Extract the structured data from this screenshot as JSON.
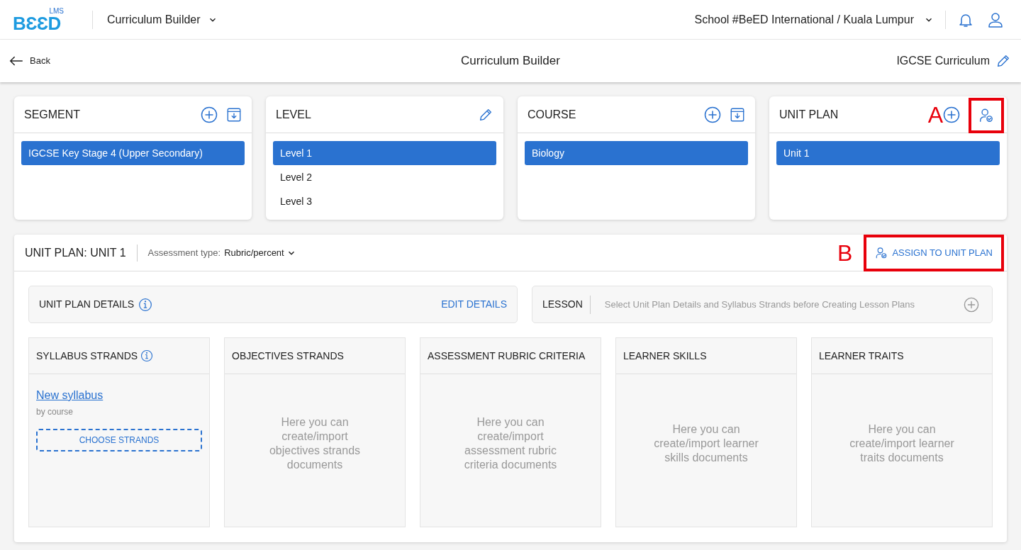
{
  "header": {
    "logo": {
      "wordmark": "BƐƐD",
      "tag": "LMS"
    },
    "app_switcher": "Curriculum Builder",
    "school": "School #BeED International / Kuala Lumpur"
  },
  "subheader": {
    "back": "Back",
    "title": "Curriculum Builder",
    "curriculum": "IGCSE Curriculum"
  },
  "panels": [
    {
      "title": "SEGMENT",
      "actions": [
        {
          "kind": "add"
        },
        {
          "kind": "archive"
        }
      ],
      "items": [
        {
          "label": "IGCSE Key Stage 4 (Upper Secondary)",
          "selected": true
        }
      ]
    },
    {
      "title": "LEVEL",
      "actions": [
        {
          "kind": "edit"
        }
      ],
      "items": [
        {
          "label": "Level 1",
          "selected": true
        },
        {
          "label": "Level 2",
          "selected": false
        },
        {
          "label": "Level 3",
          "selected": false
        }
      ]
    },
    {
      "title": "COURSE",
      "actions": [
        {
          "kind": "add"
        },
        {
          "kind": "archive"
        }
      ],
      "items": [
        {
          "label": "Biology",
          "selected": true
        }
      ]
    },
    {
      "title": "UNIT PLAN",
      "actions": [
        {
          "kind": "add",
          "annotation": "A"
        },
        {
          "kind": "assign",
          "highlighted": true
        }
      ],
      "items": [
        {
          "label": "Unit 1",
          "selected": true
        }
      ]
    }
  ],
  "unit_plan": {
    "title": "UNIT PLAN: UNIT 1",
    "assessment_label": "Assessment type:",
    "assessment_value": "Rubric/percent",
    "assign_annotation": "B",
    "assign_button": "ASSIGN TO UNIT PLAN",
    "details": {
      "title": "UNIT PLAN DETAILS",
      "action": "EDIT DETAILS"
    },
    "lesson": {
      "title": "LESSON",
      "hint": "Select Unit Plan Details and Syllabus Strands before Creating Lesson Plans"
    },
    "columns": [
      {
        "kind": "syllabus",
        "title": "SYLLABUS STRANDS",
        "link": "New syllabus",
        "sub": "by course",
        "button": "CHOOSE STRANDS"
      },
      {
        "kind": "empty",
        "title": "OBJECTIVES STRANDS",
        "text": "Here you can create/import objectives strands documents"
      },
      {
        "kind": "empty",
        "title": "ASSESSMENT RUBRIC CRITERIA",
        "text": "Here you can create/import assessment rubric criteria documents"
      },
      {
        "kind": "empty",
        "title": "LEARNER SKILLS",
        "text": "Here you can create/import learner skills documents"
      },
      {
        "kind": "empty",
        "title": "LEARNER TRAITS",
        "text": "Here you can create/import learner traits documents"
      }
    ]
  }
}
